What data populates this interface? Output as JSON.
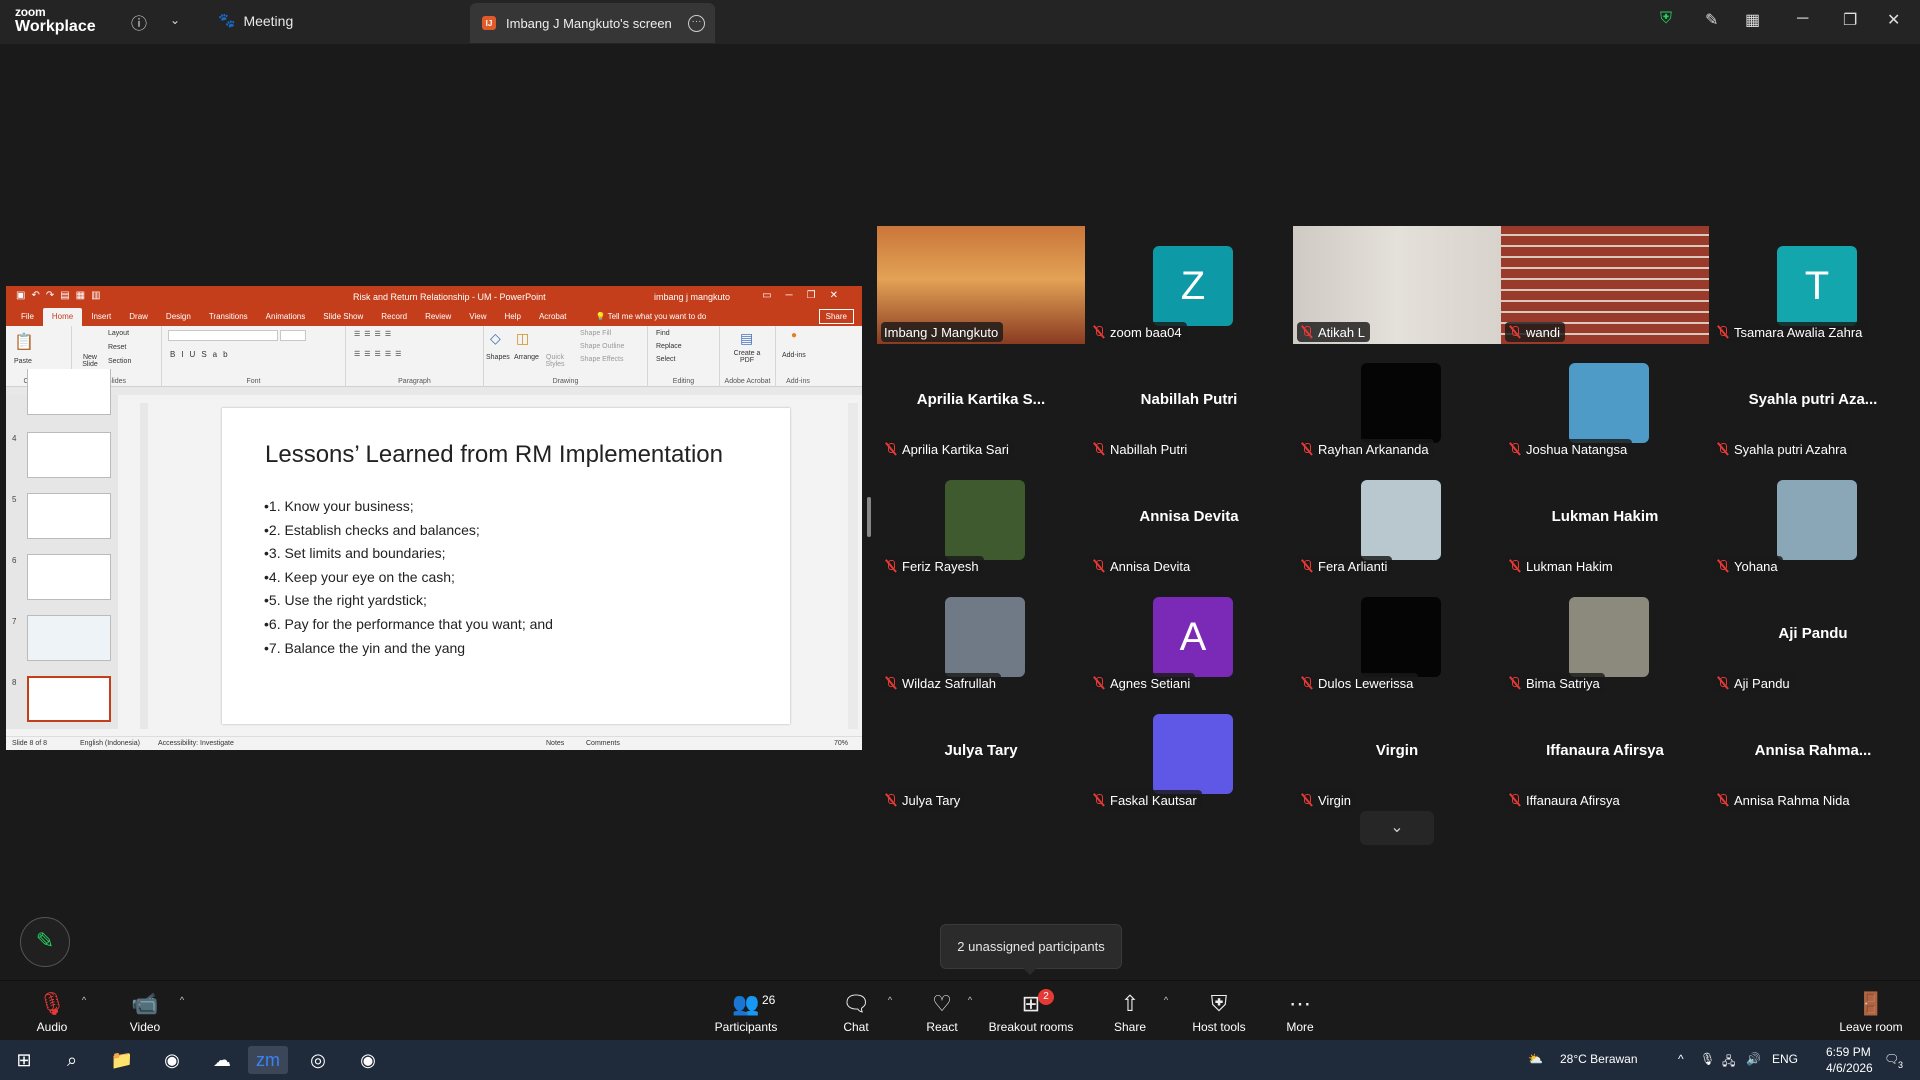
{
  "app": {
    "logo_line1": "zoom",
    "logo_line2": "Workplace"
  },
  "tabs": {
    "meeting": "Meeting",
    "screen": "Imbang J Mangkuto's screen",
    "screen_badge": "IJ"
  },
  "ppt": {
    "title": "Risk and Return Relationship - UM  -  PowerPoint",
    "user": "imbang j mangkuto",
    "menu": [
      "File",
      "Home",
      "Insert",
      "Draw",
      "Design",
      "Transitions",
      "Animations",
      "Slide Show",
      "Record",
      "Review",
      "View",
      "Help",
      "Acrobat"
    ],
    "tell_me": "Tell me what you want to do",
    "share": "Share",
    "ribbon": {
      "paste": "Paste",
      "new_slide": "New Slide",
      "layout": "Layout",
      "reset": "Reset",
      "section": "Section",
      "shapes": "Shapes",
      "arrange": "Arrange",
      "quick_styles": "Quick Styles",
      "shape_fill": "Shape Fill",
      "shape_outline": "Shape Outline",
      "shape_effects": "Shape Effects",
      "find": "Find",
      "replace": "Replace",
      "select": "Select",
      "create_pdf": "Create a PDF",
      "add_ins": "Add-ins",
      "groups": [
        "Clipboard",
        "Slides",
        "Font",
        "Paragraph",
        "Drawing",
        "Editing",
        "Adobe Acrobat",
        "Add-ins"
      ]
    },
    "thumb_numbers": [
      "4",
      "5",
      "6",
      "7",
      "8"
    ],
    "slide_title": "Lessons’ Learned from RM Implementation",
    "bullets": [
      "1. Know your business;",
      "2. Establish checks and balances;",
      "3. Set limits and boundaries;",
      "4. Keep your eye on the cash;",
      "5. Use the right yardstick;",
      "6. Pay for the performance that you want; and",
      "7. Balance the yin and the yang"
    ],
    "status": {
      "slide": "Slide 8 of 8",
      "lang": "English (Indonesia)",
      "access": "Accessibility: Investigate",
      "notes": "Notes",
      "comments": "Comments",
      "zoom": "70%"
    }
  },
  "participants": [
    {
      "name": "Imbang J Mangkuto",
      "kind": "video"
    },
    {
      "name": "zoom baa04",
      "kind": "avatar",
      "letter": "Z",
      "color": "#0d9aa6"
    },
    {
      "name": "Atikah L",
      "kind": "video2"
    },
    {
      "name": "wandi",
      "kind": "brick"
    },
    {
      "name": "Tsamara Awalia Zahra",
      "kind": "avatar",
      "letter": "T",
      "color": "#14a6ad"
    },
    {
      "name": "Aprilia Kartika Sari",
      "kind": "text",
      "big": "Aprilia  Kartika  S..."
    },
    {
      "name": "Nabillah Putri",
      "kind": "text",
      "big": "Nabillah Putri"
    },
    {
      "name": "Rayhan Arkananda",
      "kind": "photo",
      "color": "#050505"
    },
    {
      "name": "Joshua Natangsa",
      "kind": "photo",
      "color": "#4f9bc8"
    },
    {
      "name": "Syahla Azahra",
      "kind": "text",
      "big": "Syahla putri Aza...",
      "label": "Syahla putri Azahra"
    },
    {
      "name": "Feriz Rayesh",
      "kind": "photo",
      "color": "#3e5a2e"
    },
    {
      "name": "Annisa Devita",
      "kind": "text",
      "big": "Annisa Devita"
    },
    {
      "name": "Fera Arlianti",
      "kind": "photo",
      "color": "#b9c7cf"
    },
    {
      "name": "Lukman Hakim",
      "kind": "text",
      "big": "Lukman Hakim"
    },
    {
      "name": "Yohana",
      "kind": "photo",
      "color": "#8aa7b8"
    },
    {
      "name": "Wildaz Safrullah",
      "kind": "photo",
      "color": "#6f7a86"
    },
    {
      "name": "Agnes Setiani",
      "kind": "avatar",
      "letter": "A",
      "color": "#7b2ab8"
    },
    {
      "name": "Dulos Lewerissa",
      "kind": "photo",
      "color": "#050505"
    },
    {
      "name": "Bima Satriya",
      "kind": "photo",
      "color": "#8b8a7d"
    },
    {
      "name": "Aji Pandu",
      "kind": "text",
      "big": "Aji Pandu"
    },
    {
      "name": "Julya Tary",
      "kind": "text",
      "big": "Julya Tary"
    },
    {
      "name": "Faskal Kautsar",
      "kind": "photo",
      "color": "#5f57e6"
    },
    {
      "name": "Virgin",
      "kind": "text",
      "big": "Virgin"
    },
    {
      "name": "Iffanaura Afirsya",
      "kind": "text",
      "big": "Iffanaura Afirsya"
    },
    {
      "name": "Annisa Rahma Nida",
      "kind": "text",
      "big": "Annisa  Rahma..."
    }
  ],
  "tooltip": "2 unassigned participants",
  "toolbar": {
    "audio": "Audio",
    "video": "Video",
    "participants": "Participants",
    "participants_count": "26",
    "chat": "Chat",
    "react": "React",
    "breakout": "Breakout rooms",
    "breakout_badge": "2",
    "share": "Share",
    "host_tools": "Host tools",
    "more": "More",
    "leave": "Leave room"
  },
  "taskbar": {
    "weather": "28°C  Berawan",
    "lang": "ENG",
    "time": "6:59 PM",
    "date": "4/6/2026",
    "notif": "3"
  },
  "colors": {
    "accent_green": "#23d160",
    "ppt_red": "#c43e1c",
    "muted_red": "#e53935"
  }
}
